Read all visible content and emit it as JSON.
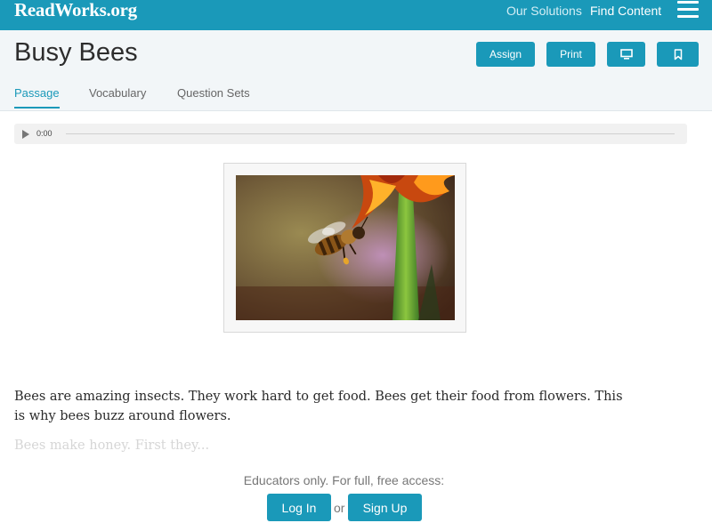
{
  "topbar": {
    "logo": "ReadWorks.org",
    "nav": {
      "solutions": "Our Solutions",
      "find_content": "Find Content"
    }
  },
  "header": {
    "title": "Busy Bees",
    "buttons": {
      "assign": "Assign",
      "print": "Print"
    },
    "tabs": [
      {
        "label": "Passage",
        "active": true
      },
      {
        "label": "Vocabulary",
        "active": false
      },
      {
        "label": "Question Sets",
        "active": false
      }
    ]
  },
  "audio": {
    "time": "0:00",
    "progress": 0
  },
  "passage": {
    "paragraph": "Bees are amazing insects. They work hard to get food. Bees get their food from flowers. This is why bees buzz around flowers.",
    "faded": "Bees make honey. First they..."
  },
  "access": {
    "message": "Educators only. For full, free access:",
    "login": "Log In",
    "or": "or",
    "signup": "Sign Up"
  },
  "icons": {
    "menu": "hamburger-icon",
    "present": "monitor-icon",
    "bookmark": "bookmark-icon",
    "play": "play-icon"
  },
  "colors": {
    "brand": "#1a99b9",
    "header_bg": "#f2f6f8",
    "text": "#2d2d2d"
  }
}
